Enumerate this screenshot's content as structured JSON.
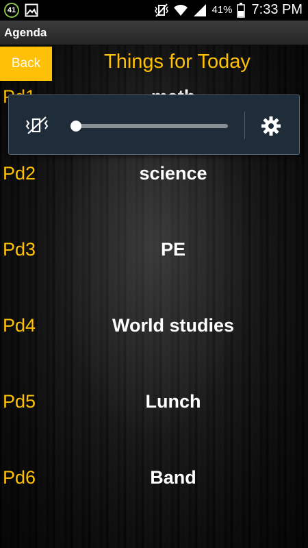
{
  "status_bar": {
    "notification_count": "41",
    "battery_percent": "41%",
    "time": "7:33 PM",
    "icons": [
      "notification-badge",
      "image-icon",
      "vibrate-mute-icon",
      "wifi-icon",
      "signal-icon",
      "battery-icon"
    ]
  },
  "app": {
    "title": "Agenda"
  },
  "header": {
    "back_label": "Back",
    "page_title": "Things for Today"
  },
  "periods": [
    {
      "label": "Pd1",
      "value": "math"
    },
    {
      "label": "Pd2",
      "value": "science"
    },
    {
      "label": "Pd3",
      "value": "PE"
    },
    {
      "label": "Pd4",
      "value": "World studies"
    },
    {
      "label": "Pd5",
      "value": "Lunch"
    },
    {
      "label": "Pd6",
      "value": "Band"
    }
  ],
  "volume_popup": {
    "level": 0.0,
    "muted": true,
    "icons": [
      "mute-icon",
      "settings-icon"
    ]
  },
  "colors": {
    "accent": "#ffc107",
    "popup_bg": "#1f2d3a"
  }
}
